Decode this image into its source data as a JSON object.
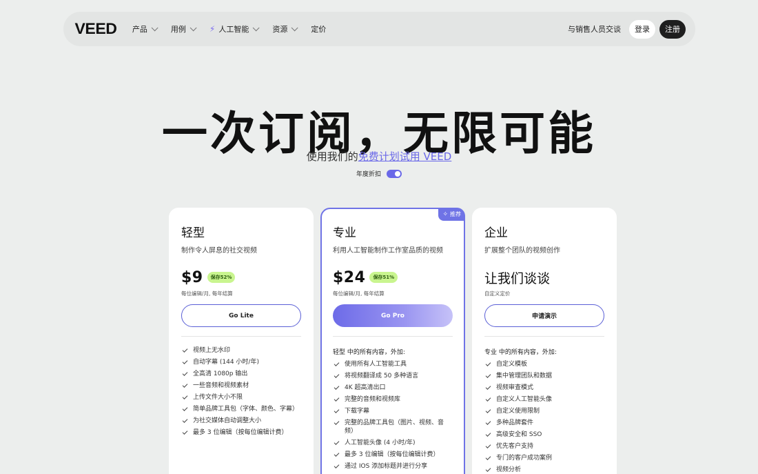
{
  "nav": {
    "logo": "VEED",
    "items": [
      {
        "label": "产品",
        "has_chevron": true
      },
      {
        "label": "用例",
        "has_chevron": true
      },
      {
        "label": "人工智能",
        "has_chevron": true,
        "icon": "bolt-icon"
      },
      {
        "label": "资源",
        "has_chevron": true
      },
      {
        "label": "定价",
        "has_chevron": false
      }
    ],
    "sales_link": "与销售人员交谈",
    "login": "登录",
    "signup": "注册"
  },
  "hero": {
    "title": "一次订阅，无限可能",
    "subtitle_prefix": "使用我们的",
    "subtitle_link": "免费计划试用 VEED",
    "toggle_label": "年度折扣",
    "toggle_on": true
  },
  "colors": {
    "accent": "#6a68e8",
    "badge_green": "#c9f58f",
    "signup_bg": "#1e1e1e"
  },
  "plans": [
    {
      "name": "轻型",
      "desc": "制作令人屏息的社交视频",
      "price": "$9",
      "save": "保存52%",
      "price_note": "每位编辑/月, 每年结算",
      "cta": "Go Lite",
      "features_head": "",
      "features": [
        "视频上无水印",
        "自动字幕 (144 小时/年)",
        "全高清 1080p 输出",
        "一些音频和视频素材",
        "上传文件大小不限",
        "简单品牌工具包（字体、颜色、字幕）",
        "为社交媒体自动调整大小",
        "最多 3 位编辑（按每位编辑计费）"
      ]
    },
    {
      "name": "专业",
      "desc": "利用人工智能制作工作室品质的视频",
      "price": "$24",
      "save": "保存51%",
      "price_note": "每位编辑/月, 每年结算",
      "cta": "Go Pro",
      "badge": "推荐",
      "features_head": "轻型 中的所有内容，外加:",
      "features": [
        "使用所有人工智能工具",
        "将视频翻译成 50 多种语言",
        "4K 超高清出口",
        "完整的音频和视频库",
        "下载字幕",
        "完整的品牌工具包（图片、视频、音频）",
        "人工智能头像 (4 小时/年)",
        "最多 3 位编辑（按每位编辑计费）",
        "通过 IOS 添加标题并进行分享"
      ]
    },
    {
      "name": "企业",
      "desc": "扩展整个团队的视频创作",
      "price": "让我们谈谈",
      "price_note": "自定义定价",
      "cta": "申请演示",
      "features_head": "专业 中的所有内容，外加:",
      "features": [
        "自定义模板",
        "集中管理团队和数据",
        "视频审查模式",
        "自定义人工智能头像",
        "自定义使用限制",
        "多种品牌套件",
        "高级安全和 SSO",
        "优先客户支持",
        "专门的客户成功案例",
        "视频分析"
      ]
    }
  ]
}
